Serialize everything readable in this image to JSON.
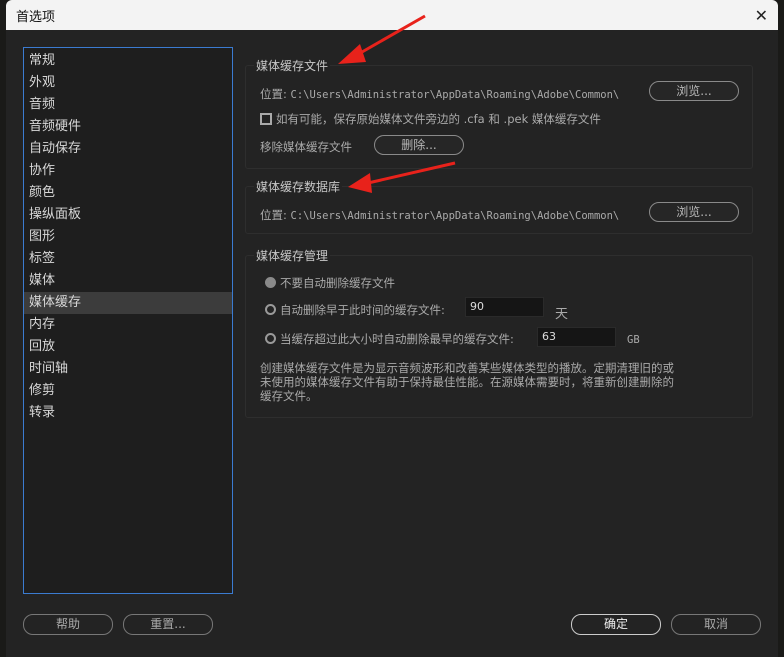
{
  "title": "首选项",
  "sidebar": [
    "常规",
    "外观",
    "音频",
    "音频硬件",
    "自动保存",
    "协作",
    "颜色",
    "操纵面板",
    "图形",
    "标签",
    "媒体",
    "媒体缓存",
    "内存",
    "回放",
    "时间轴",
    "修剪",
    "转录"
  ],
  "selected_index": 11,
  "cache_files": {
    "title": "媒体缓存文件",
    "location_label": "位置:",
    "location": "C:\\Users\\Administrator\\AppData\\Roaming\\Adobe\\Common\\",
    "browse": "浏览...",
    "checkbox_label": "如有可能，保存原始媒体文件旁边的 .cfa 和 .pek 媒体缓存文件",
    "checkbox_checked": false,
    "remove_label": "移除媒体缓存文件",
    "delete": "删除..."
  },
  "cache_db": {
    "title": "媒体缓存数据库",
    "location_label": "位置:",
    "location": "C:\\Users\\Administrator\\AppData\\Roaming\\Adobe\\Common\\",
    "browse": "浏览..."
  },
  "management": {
    "title": "媒体缓存管理",
    "opt1": "不要自动删除缓存文件",
    "opt2": "自动删除早于此时间的缓存文件:",
    "opt2_value": "90",
    "opt2_unit": "天",
    "opt3": "当缓存超过此大小时自动删除最早的缓存文件:",
    "opt3_value": "63",
    "opt3_unit": "GB",
    "note": "创建媒体缓存文件是为显示音频波形和改善某些媒体类型的播放。定期清理旧的或未使用的媒体缓存文件有助于保持最佳性能。在源媒体需要时，将重新创建删除的缓存文件。"
  },
  "footer": {
    "help": "帮助",
    "reset": "重置...",
    "ok": "确定",
    "cancel": "取消"
  },
  "colors": {
    "accent": "#3b7bd0",
    "arrow": "#e8221b"
  }
}
